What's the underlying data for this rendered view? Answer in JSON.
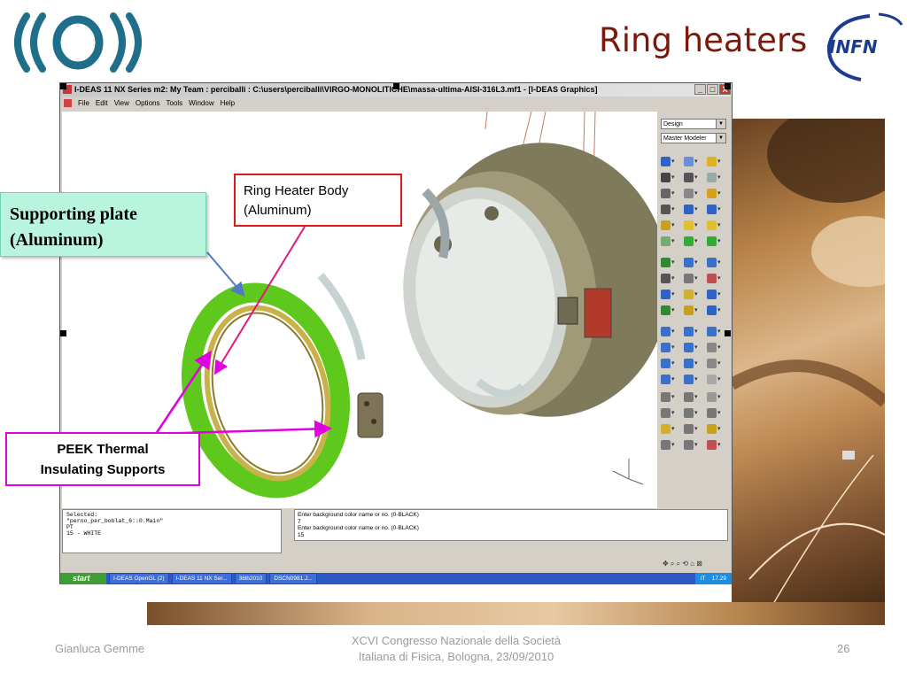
{
  "slide": {
    "title": "Ring heaters",
    "footer_left": "Gianluca Gemme",
    "footer_center_line1": "XCVI Congresso Nazionale della Società",
    "footer_center_line2": "Italiana di Fisica, Bologna, 23/09/2010",
    "page_number": "26"
  },
  "logos": {
    "left_logo_icon": "virgo-logo-icon",
    "right_logo_text": "INFN"
  },
  "app": {
    "window_title": "I-DEAS 11 NX Series m2:    My Team : perciballi : C:\\users\\perciballi\\VIRGO-MONOLITICHE\\massa-ultima-AISI-316L3.mf1 - [I-DEAS Graphics]",
    "window_buttons": [
      "_",
      "□",
      "X"
    ],
    "menu": [
      "File",
      "Edit",
      "View",
      "Options",
      "Tools",
      "Window",
      "Help"
    ],
    "dropdowns": {
      "task": "Design",
      "application": "Master Modeler"
    },
    "console_lines": [
      "Selected:",
      "\"perno_per_boblat_6::0.Main\"",
      "PT",
      "15 - WHITE"
    ],
    "prompt_lines": [
      "Enter background color name or no. (0-BLACK)",
      "7",
      "Enter background color name or no. (0-BLACK)",
      "15"
    ]
  },
  "taskbar": {
    "start_label": "start",
    "tasks": [
      "I-DEAS OpenGL (2)",
      "I-DEAS 11 NX Ser...",
      "36lb2010",
      "DSCN0981.J..."
    ],
    "tray_language": "IT",
    "clock": "17.29"
  },
  "annotations": {
    "supporting_plate_line1": "Supporting plate",
    "supporting_plate_line2": "(Aluminum)",
    "ring_body_line1": "Ring Heater Body",
    "ring_body_line2": "(Aluminum)",
    "peek_line1": "PEEK Thermal",
    "peek_line2": "Insulating Supports"
  },
  "colors": {
    "title": "#7a1a0a",
    "callout_green_bg": "#b9f5de",
    "callout_red_border": "#e01a1a",
    "callout_magenta_border": "#e000e0",
    "plate_green": "#6dd91f",
    "ring_metal": "#8a8160"
  }
}
